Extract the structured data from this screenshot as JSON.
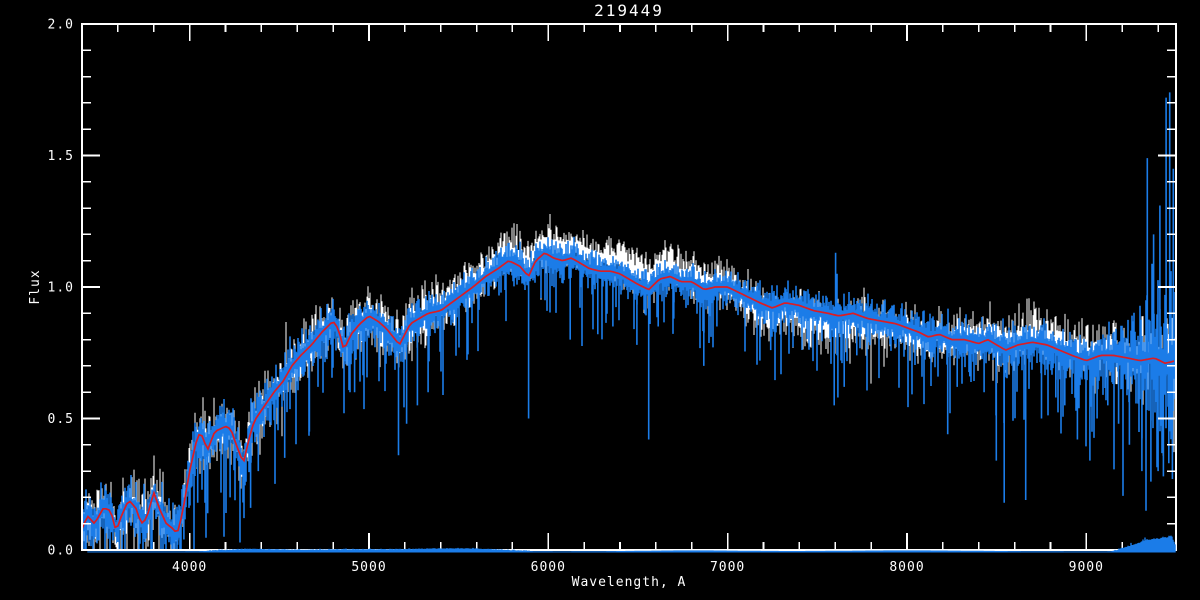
{
  "window": {
    "background": "#000000"
  },
  "chart_data": {
    "type": "line",
    "title": "219449",
    "xlabel": "Wavelength, A",
    "ylabel": "Flux",
    "xlim": [
      3400,
      9500
    ],
    "ylim": [
      0.0,
      2.0
    ],
    "grid": "off",
    "frame": "full-box-inward-ticks",
    "x_ticks": {
      "major": [
        4000,
        5000,
        6000,
        7000,
        8000,
        9000
      ],
      "labels": [
        "4000",
        "5000",
        "6000",
        "7000",
        "8000",
        "9000"
      ],
      "minor_step": 200
    },
    "y_ticks": {
      "major": [
        0.0,
        0.5,
        1.0,
        1.5,
        2.0
      ],
      "labels": [
        "0.0",
        "0.5",
        "1.0",
        "1.5",
        "2.0"
      ],
      "minor_step": 0.1
    },
    "colors": {
      "background": "#000000",
      "axis": "#ffffff",
      "observed": "#ffffff",
      "template": "#1b7ce8",
      "fit": "#dd1c22",
      "sky": "#1b7ce8"
    },
    "series": [
      {
        "name": "observed-spectrum",
        "style": "noisy-trace",
        "color": "#ffffff"
      },
      {
        "name": "template-spectrum",
        "style": "noisy-trace-with-absorption-lines",
        "color": "#1b7ce8"
      },
      {
        "name": "smoothed-fit",
        "style": "smooth-line",
        "color": "#dd1c22"
      },
      {
        "name": "sky-spectrum",
        "style": "near-zero-trace",
        "color": "#1b7ce8"
      }
    ],
    "continuum": [
      [
        3400,
        0.08
      ],
      [
        3430,
        0.13
      ],
      [
        3470,
        0.1
      ],
      [
        3520,
        0.16
      ],
      [
        3560,
        0.15
      ],
      [
        3590,
        0.07
      ],
      [
        3620,
        0.13
      ],
      [
        3660,
        0.19
      ],
      [
        3700,
        0.16
      ],
      [
        3730,
        0.1
      ],
      [
        3760,
        0.12
      ],
      [
        3800,
        0.22
      ],
      [
        3830,
        0.16
      ],
      [
        3870,
        0.1
      ],
      [
        3910,
        0.08
      ],
      [
        3930,
        0.06
      ],
      [
        3960,
        0.14
      ],
      [
        4000,
        0.3
      ],
      [
        4040,
        0.42
      ],
      [
        4060,
        0.45
      ],
      [
        4100,
        0.38
      ],
      [
        4140,
        0.45
      ],
      [
        4200,
        0.47
      ],
      [
        4230,
        0.46
      ],
      [
        4260,
        0.4
      ],
      [
        4300,
        0.33
      ],
      [
        4330,
        0.42
      ],
      [
        4360,
        0.49
      ],
      [
        4420,
        0.55
      ],
      [
        4470,
        0.6
      ],
      [
        4520,
        0.64
      ],
      [
        4570,
        0.7
      ],
      [
        4620,
        0.74
      ],
      [
        4680,
        0.78
      ],
      [
        4740,
        0.83
      ],
      [
        4800,
        0.87
      ],
      [
        4830,
        0.84
      ],
      [
        4860,
        0.76
      ],
      [
        4900,
        0.82
      ],
      [
        4950,
        0.86
      ],
      [
        5000,
        0.89
      ],
      [
        5050,
        0.87
      ],
      [
        5100,
        0.84
      ],
      [
        5170,
        0.78
      ],
      [
        5230,
        0.86
      ],
      [
        5280,
        0.88
      ],
      [
        5330,
        0.9
      ],
      [
        5400,
        0.91
      ],
      [
        5460,
        0.94
      ],
      [
        5520,
        0.97
      ],
      [
        5580,
        1.0
      ],
      [
        5650,
        1.04
      ],
      [
        5720,
        1.07
      ],
      [
        5780,
        1.1
      ],
      [
        5840,
        1.08
      ],
      [
        5890,
        1.04
      ],
      [
        5930,
        1.1
      ],
      [
        5980,
        1.13
      ],
      [
        6030,
        1.11
      ],
      [
        6080,
        1.1
      ],
      [
        6130,
        1.11
      ],
      [
        6180,
        1.09
      ],
      [
        6230,
        1.07
      ],
      [
        6290,
        1.06
      ],
      [
        6350,
        1.06
      ],
      [
        6400,
        1.05
      ],
      [
        6450,
        1.03
      ],
      [
        6500,
        1.01
      ],
      [
        6560,
        0.99
      ],
      [
        6620,
        1.03
      ],
      [
        6680,
        1.04
      ],
      [
        6740,
        1.02
      ],
      [
        6800,
        1.02
      ],
      [
        6870,
        0.99
      ],
      [
        6930,
        1.0
      ],
      [
        7000,
        1.0
      ],
      [
        7060,
        0.98
      ],
      [
        7120,
        0.96
      ],
      [
        7180,
        0.94
      ],
      [
        7250,
        0.92
      ],
      [
        7320,
        0.94
      ],
      [
        7400,
        0.93
      ],
      [
        7480,
        0.91
      ],
      [
        7560,
        0.9
      ],
      [
        7620,
        0.89
      ],
      [
        7700,
        0.9
      ],
      [
        7780,
        0.88
      ],
      [
        7860,
        0.87
      ],
      [
        7940,
        0.86
      ],
      [
        8000,
        0.845
      ],
      [
        8060,
        0.83
      ],
      [
        8120,
        0.81
      ],
      [
        8180,
        0.82
      ],
      [
        8250,
        0.8
      ],
      [
        8320,
        0.8
      ],
      [
        8400,
        0.785
      ],
      [
        8450,
        0.8
      ],
      [
        8500,
        0.78
      ],
      [
        8550,
        0.76
      ],
      [
        8620,
        0.78
      ],
      [
        8700,
        0.79
      ],
      [
        8780,
        0.78
      ],
      [
        8850,
        0.76
      ],
      [
        8920,
        0.74
      ],
      [
        9000,
        0.72
      ],
      [
        9080,
        0.74
      ],
      [
        9150,
        0.74
      ],
      [
        9230,
        0.73
      ],
      [
        9300,
        0.72
      ],
      [
        9380,
        0.73
      ],
      [
        9440,
        0.71
      ],
      [
        9500,
        0.72
      ]
    ],
    "white_offset": [
      [
        3400,
        0.0
      ],
      [
        5000,
        0.0
      ],
      [
        5500,
        0.01
      ],
      [
        5800,
        0.035
      ],
      [
        6100,
        0.05
      ],
      [
        6500,
        0.05
      ],
      [
        6800,
        0.03
      ],
      [
        7050,
        0.0
      ],
      [
        7200,
        -0.03
      ],
      [
        7500,
        -0.04
      ],
      [
        7900,
        -0.03
      ],
      [
        8150,
        -0.01
      ],
      [
        8350,
        0.02
      ],
      [
        8700,
        0.03
      ],
      [
        9000,
        0.03
      ],
      [
        9200,
        0.02
      ],
      [
        9500,
        0.03
      ]
    ],
    "white_sigma": [
      [
        3400,
        0.055
      ],
      [
        3700,
        0.06
      ],
      [
        4000,
        0.06
      ],
      [
        4300,
        0.06
      ],
      [
        4600,
        0.055
      ],
      [
        5000,
        0.05
      ],
      [
        5400,
        0.05
      ],
      [
        5800,
        0.045
      ],
      [
        6200,
        0.04
      ],
      [
        6600,
        0.04
      ],
      [
        7000,
        0.04
      ],
      [
        7400,
        0.045
      ],
      [
        7800,
        0.045
      ],
      [
        8200,
        0.045
      ],
      [
        8600,
        0.05
      ],
      [
        9000,
        0.05
      ],
      [
        9250,
        0.06
      ],
      [
        9500,
        0.09
      ]
    ],
    "blue_sigma": [
      [
        3400,
        0.05
      ],
      [
        3800,
        0.055
      ],
      [
        4200,
        0.055
      ],
      [
        4600,
        0.05
      ],
      [
        5000,
        0.045
      ],
      [
        5400,
        0.04
      ],
      [
        5800,
        0.04
      ],
      [
        6200,
        0.035
      ],
      [
        6600,
        0.035
      ],
      [
        7000,
        0.035
      ],
      [
        7400,
        0.04
      ],
      [
        7800,
        0.04
      ],
      [
        8200,
        0.045
      ],
      [
        8600,
        0.045
      ],
      [
        9000,
        0.05
      ],
      [
        9200,
        0.08
      ],
      [
        9350,
        0.16
      ],
      [
        9500,
        0.22
      ]
    ],
    "absorption_dips": [
      [
        3933,
        0.02
      ],
      [
        3968,
        0.04
      ],
      [
        4045,
        0.18
      ],
      [
        4101,
        0.14
      ],
      [
        4226,
        0.2
      ],
      [
        4300,
        0.19
      ],
      [
        4340,
        0.16
      ],
      [
        4383,
        0.3
      ],
      [
        4530,
        0.35
      ],
      [
        4668,
        0.45
      ],
      [
        4861,
        0.52
      ],
      [
        4920,
        0.6
      ],
      [
        5165,
        0.36
      ],
      [
        5210,
        0.48
      ],
      [
        5270,
        0.55
      ],
      [
        5330,
        0.6
      ],
      [
        5890,
        0.5
      ],
      [
        6122,
        0.8
      ],
      [
        6276,
        0.82
      ],
      [
        6360,
        0.85
      ],
      [
        6494,
        0.78
      ],
      [
        6560,
        0.42
      ],
      [
        6613,
        0.85
      ],
      [
        6700,
        0.88
      ],
      [
        6867,
        0.7
      ],
      [
        6940,
        0.85
      ],
      [
        7180,
        0.72
      ],
      [
        7240,
        0.76
      ],
      [
        7594,
        0.55
      ],
      [
        7615,
        0.58
      ],
      [
        7650,
        0.62
      ],
      [
        7720,
        0.74
      ],
      [
        8227,
        0.44
      ],
      [
        8280,
        0.62
      ],
      [
        8350,
        0.66
      ],
      [
        8430,
        0.6
      ],
      [
        8498,
        0.34
      ],
      [
        8542,
        0.18
      ],
      [
        8662,
        0.19
      ],
      [
        8750,
        0.5
      ],
      [
        8830,
        0.58
      ],
      [
        8880,
        0.55
      ],
      [
        8950,
        0.42
      ],
      [
        9020,
        0.34
      ],
      [
        9060,
        0.5
      ],
      [
        9120,
        0.55
      ],
      [
        9180,
        0.48
      ],
      [
        9240,
        0.4
      ],
      [
        9310,
        0.3
      ],
      [
        9360,
        0.26
      ],
      [
        9400,
        0.3
      ],
      [
        9430,
        0.28
      ],
      [
        9460,
        0.33
      ],
      [
        9480,
        0.27
      ]
    ],
    "emission_spikes": [
      [
        7602,
        1.13
      ],
      [
        7610,
        1.05
      ],
      [
        9340,
        1.49
      ],
      [
        9375,
        1.2
      ],
      [
        9410,
        1.31
      ],
      [
        9445,
        1.72
      ],
      [
        9465,
        1.74
      ],
      [
        9485,
        1.45
      ]
    ],
    "sky": {
      "level": 0.004,
      "bumps": [
        [
          4350,
          0.008,
          150
        ],
        [
          4800,
          0.006,
          200
        ],
        [
          5300,
          0.008,
          250
        ],
        [
          5600,
          0.006,
          150
        ],
        [
          6800,
          0.004,
          300
        ],
        [
          8000,
          0.004,
          400
        ],
        [
          9230,
          0.015,
          40
        ],
        [
          9290,
          0.02,
          30
        ],
        [
          9340,
          0.035,
          25
        ],
        [
          9380,
          0.025,
          20
        ],
        [
          9420,
          0.04,
          25
        ],
        [
          9455,
          0.03,
          18
        ],
        [
          9480,
          0.035,
          15
        ]
      ]
    }
  }
}
